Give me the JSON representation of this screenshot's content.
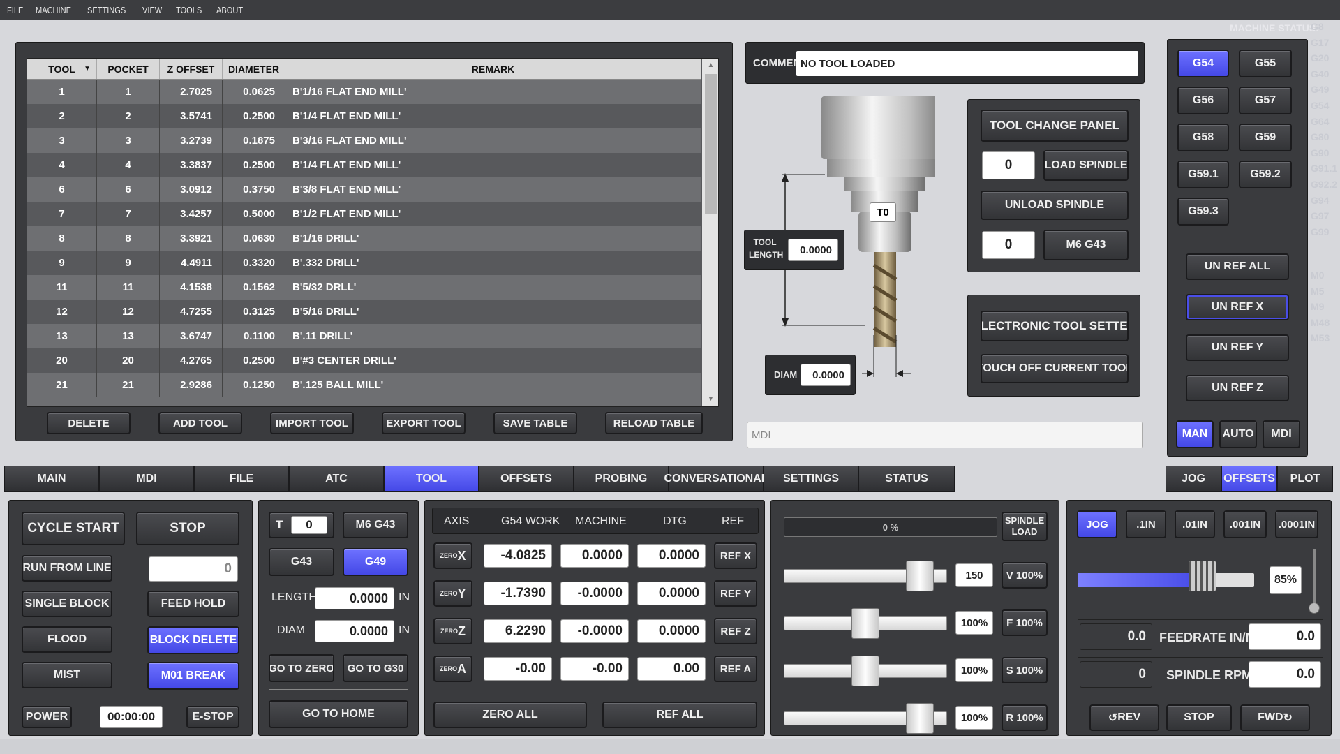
{
  "menu": [
    "FILE",
    "MACHINE",
    "SETTINGS",
    "VIEW",
    "TOOLS",
    "ABOUT"
  ],
  "table": {
    "headers": [
      "TOOL",
      "POCKET",
      "Z OFFSET",
      "DIAMETER",
      "REMARK"
    ],
    "rows": [
      [
        "1",
        "1",
        "2.7025",
        "0.0625",
        "B'1/16 FLAT END MILL'"
      ],
      [
        "2",
        "2",
        "3.5741",
        "0.2500",
        "B'1/4 FLAT END MILL'"
      ],
      [
        "3",
        "3",
        "3.2739",
        "0.1875",
        "B'3/16 FLAT END MILL'"
      ],
      [
        "4",
        "4",
        "3.3837",
        "0.2500",
        "B'1/4 FLAT END MILL'"
      ],
      [
        "6",
        "6",
        "3.0912",
        "0.3750",
        "B'3/8 FLAT END MILL'"
      ],
      [
        "7",
        "7",
        "3.4257",
        "0.5000",
        "B'1/2 FLAT END MILL'"
      ],
      [
        "8",
        "8",
        "3.3921",
        "0.0630",
        "B'1/16 DRILL'"
      ],
      [
        "9",
        "9",
        "4.4911",
        "0.3320",
        "B'.332 DRILL'"
      ],
      [
        "11",
        "11",
        "4.1538",
        "0.1562",
        "B'5/32 DRLL'"
      ],
      [
        "12",
        "12",
        "4.7255",
        "0.3125",
        "B'5/16 DRILL'"
      ],
      [
        "13",
        "13",
        "3.6747",
        "0.1100",
        "B'.11 DRILL'"
      ],
      [
        "20",
        "20",
        "4.2765",
        "0.2500",
        "B'#3 CENTER DRILL'"
      ],
      [
        "21",
        "21",
        "2.9286",
        "0.1250",
        "B'.125 BALL MILL'"
      ]
    ],
    "buttons": [
      "DELETE",
      "ADD TOOL",
      "IMPORT TOOL",
      "EXPORT TOOL",
      "SAVE TABLE",
      "RELOAD TABLE"
    ]
  },
  "comment": {
    "label": "COMMENT",
    "value": "NO TOOL LOADED"
  },
  "tool_graphic": {
    "tool_label": "T0",
    "length_label": "TOOL\nLENGTH",
    "length_value": "0.0000",
    "diam_label": "DIAM",
    "diam_value": "0.0000"
  },
  "tool_change": {
    "title": "TOOL CHANGE PANEL",
    "field1": "0",
    "load": "LOAD SPINDLE",
    "unload": "UNLOAD SPINDLE",
    "field2": "0",
    "m6": "M6 G43"
  },
  "tool_setter": {
    "title": "ELECTRONIC TOOL SETTER",
    "touch": "TOUCH OFF CURRENT TOOL"
  },
  "mdi_placeholder": "MDI",
  "right": {
    "machine_status": "MACHINE STATUS:",
    "wcs": [
      "G54",
      "G55",
      "G56",
      "G57",
      "G58",
      "G59",
      "G59.1",
      "G59.2",
      "G59.3"
    ],
    "unref": [
      "UN REF ALL",
      "UN REF X",
      "UN REF Y",
      "UN REF Z"
    ],
    "modes": [
      "MAN",
      "AUTO",
      "MDI"
    ],
    "gcodes": [
      "G8",
      "G17",
      "G20",
      "G40",
      "G49",
      "G54",
      "G64",
      "G80",
      "G90",
      "G91.1",
      "G92.2",
      "G94",
      "G97",
      "G99"
    ],
    "mcodes": [
      "M0",
      "M5",
      "M9",
      "M48",
      "M53"
    ]
  },
  "tabs": [
    "MAIN",
    "MDI",
    "FILE",
    "ATC",
    "TOOL",
    "OFFSETS",
    "PROBING",
    "CONVERSATIONAL",
    "SETTINGS",
    "STATUS"
  ],
  "right_tabs": [
    "JOG",
    "OFFSETS",
    "PLOT"
  ],
  "control": {
    "cycle_start": "CYCLE START",
    "stop": "STOP",
    "run_from_line": "RUN FROM LINE",
    "rfl_value": "0",
    "single_block": "SINGLE BLOCK",
    "feed_hold": "FEED HOLD",
    "flood": "FLOOD",
    "block_delete": "BLOCK DELETE",
    "mist": "MIST",
    "m01": "M01 BREAK",
    "power": "POWER",
    "timer": "00:00:00",
    "estop": "E-STOP"
  },
  "toolpanel": {
    "t": "T",
    "t_value": "0",
    "m6g43": "M6 G43",
    "g43": "G43",
    "g49": "G49",
    "length": "LENGTH",
    "length_value": "0.0000",
    "diam": "DIAM",
    "diam_value": "0.0000",
    "unit": "IN",
    "goto_zero": "GO TO ZERO",
    "goto_g30": "GO TO G30",
    "goto_home": "GO TO HOME"
  },
  "dro": {
    "headers": [
      "AXIS",
      "G54 WORK",
      "MACHINE",
      "DTG",
      "REF"
    ],
    "rows": [
      {
        "zero": "ZERO",
        "axis": "X",
        "work": "-4.0825",
        "machine": "0.0000",
        "dtg": "0.0000",
        "ref": "REF X"
      },
      {
        "zero": "ZERO",
        "axis": "Y",
        "work": "-1.7390",
        "machine": "-0.0000",
        "dtg": "0.0000",
        "ref": "REF Y"
      },
      {
        "zero": "ZERO",
        "axis": "Z",
        "work": "6.2290",
        "machine": "-0.0000",
        "dtg": "0.0000",
        "ref": "REF Z"
      },
      {
        "zero": "ZERO",
        "axis": "A",
        "work": "-0.00",
        "machine": "-0.00",
        "dtg": "0.00",
        "ref": "REF A"
      }
    ],
    "zero_all": "ZERO ALL",
    "ref_all": "REF ALL"
  },
  "overrides": {
    "spindle_load": "0 %",
    "spindle_load_fraction": 0.0,
    "spindle_load_label": "SPINDLE\nLOAD",
    "rows": [
      {
        "value": "150",
        "btn": "V 100%",
        "level": 0.9
      },
      {
        "value": "100%",
        "btn": "F 100%",
        "level": 0.5
      },
      {
        "value": "100%",
        "btn": "S 100%",
        "level": 0.5
      },
      {
        "value": "100%",
        "btn": "R 100%",
        "level": 0.9
      }
    ]
  },
  "jog": {
    "increments": [
      "JOG",
      ".1IN",
      ".01IN",
      ".001IN",
      ".0001IN"
    ],
    "jog_percent": "85%",
    "jog_level": 0.85,
    "feed_left": "0.0",
    "feed_label": "FEEDRATE IN/M",
    "feed_right": "0.0",
    "rpm_left": "0",
    "rpm_label": "SPINDLE RPM",
    "rpm_right": "0.0",
    "rev": "REV",
    "stop": "STOP",
    "fwd": "FWD"
  },
  "colors": {
    "accent": "#4a4ee8",
    "panel": "#2d2e31",
    "bg": "#d7d8dc"
  }
}
